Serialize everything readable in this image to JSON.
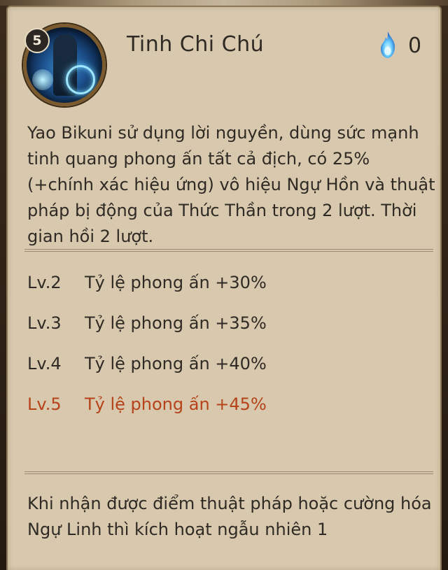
{
  "skill": {
    "name": "Tinh Chi Chú",
    "level": "5",
    "cost": "0",
    "icon": "skill-portrait-icon",
    "cost_icon": "blue-soul-flame-icon"
  },
  "description": "Yao Bikuni sử dụng lời nguyền, dùng sức mạnh tinh quang phong ấn tất cả địch, có 25% (+chính xác hiệu ứng) vô hiệu Ngự Hồn và thuật pháp bị động của Thức Thần trong 2 lượt. Thời gian hồi 2 lượt.",
  "levels": [
    {
      "lv": "Lv.2",
      "text": "Tỷ lệ phong ấn +30%"
    },
    {
      "lv": "Lv.3",
      "text": "Tỷ lệ phong ấn +35%"
    },
    {
      "lv": "Lv.4",
      "text": "Tỷ lệ phong ấn +40%"
    },
    {
      "lv": "Lv.5",
      "text": "Tỷ lệ phong ấn +45%"
    }
  ],
  "footer": "Khi nhận được điểm thuật pháp hoặc cường hóa Ngự Linh thì kích hoạt ngẫu nhiên 1",
  "colors": {
    "panel": "#d8c9ae",
    "text": "#2f2a24",
    "active_level": "#b54219"
  }
}
